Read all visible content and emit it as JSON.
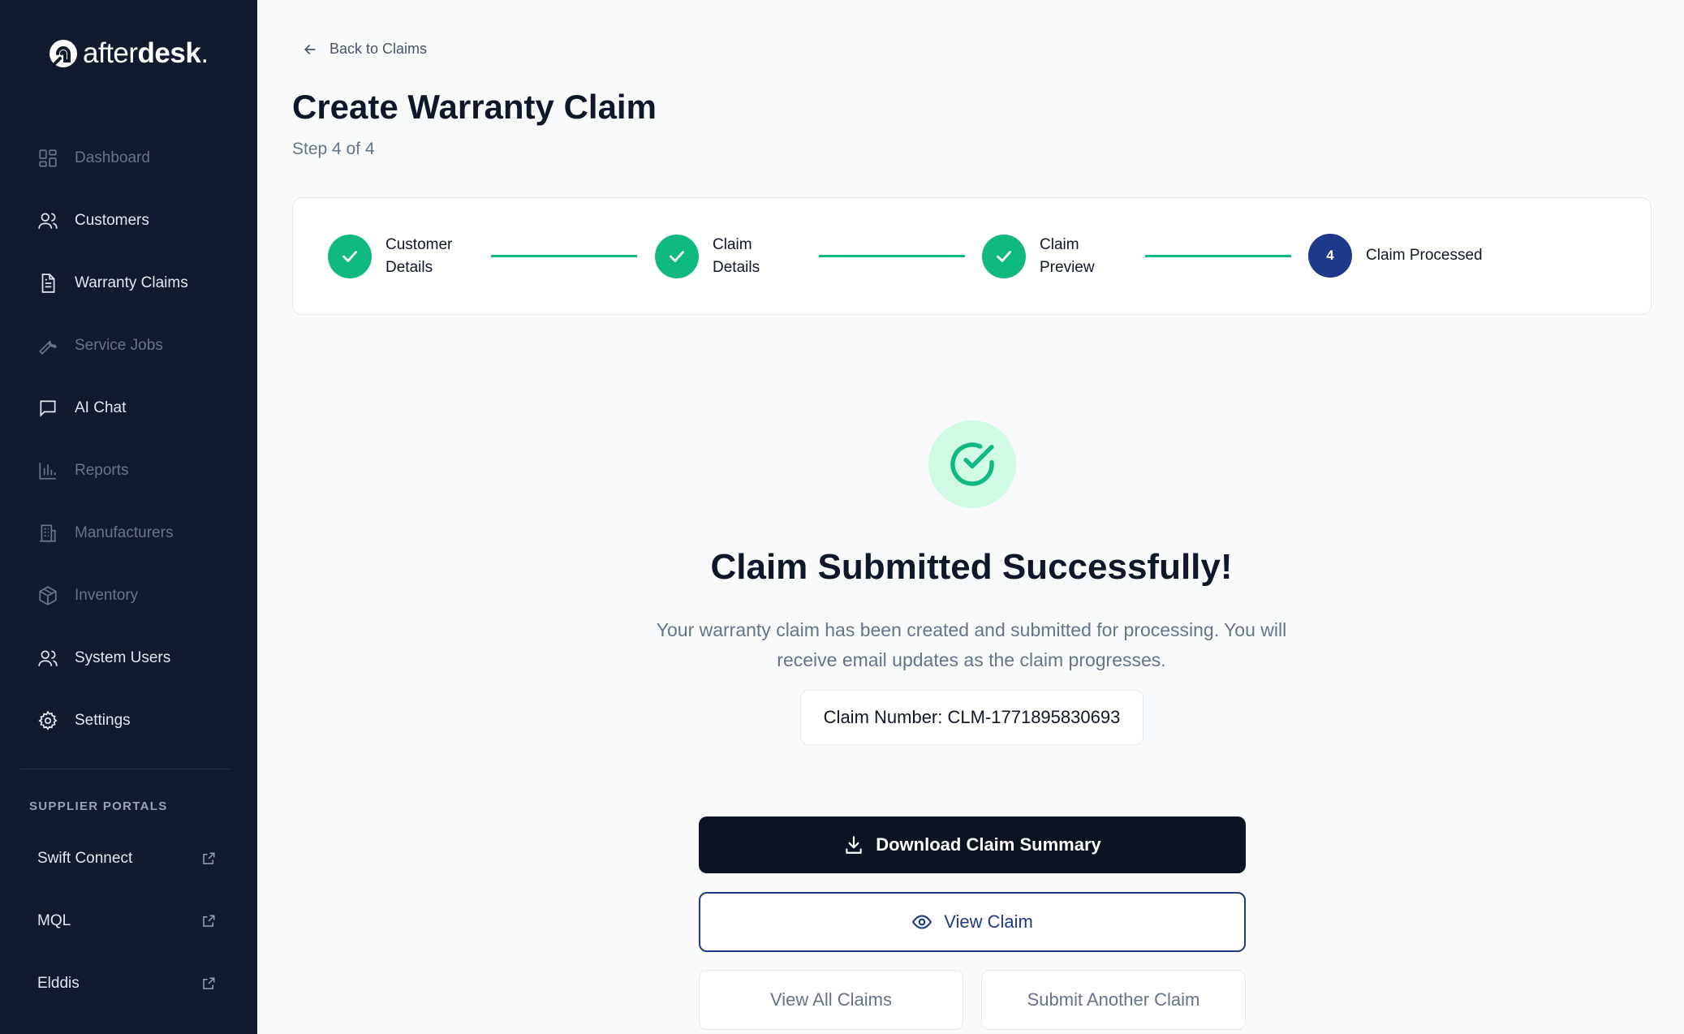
{
  "sidebar": {
    "brand": {
      "light": "after",
      "bold": "desk",
      "dot": "."
    },
    "items": [
      {
        "label": "Dashboard",
        "icon": "dashboard-icon",
        "dim": true
      },
      {
        "label": "Customers",
        "icon": "users-icon",
        "dim": false
      },
      {
        "label": "Warranty Claims",
        "icon": "document-icon",
        "dim": false
      },
      {
        "label": "Service Jobs",
        "icon": "wrench-icon",
        "dim": true
      },
      {
        "label": "AI Chat",
        "icon": "chat-icon",
        "dim": false
      },
      {
        "label": "Reports",
        "icon": "bar-chart-icon",
        "dim": true
      },
      {
        "label": "Manufacturers",
        "icon": "building-icon",
        "dim": true
      },
      {
        "label": "Inventory",
        "icon": "box-icon",
        "dim": true
      },
      {
        "label": "System Users",
        "icon": "users-icon",
        "dim": false
      },
      {
        "label": "Settings",
        "icon": "gear-icon",
        "dim": false
      }
    ],
    "portals_title": "SUPPLIER PORTALS",
    "portals": [
      {
        "label": "Swift Connect",
        "icon": "external-link-icon"
      },
      {
        "label": "MQL",
        "icon": "external-link-icon"
      },
      {
        "label": "Elddis",
        "icon": "external-link-icon"
      }
    ]
  },
  "header": {
    "back_label": "Back to Claims",
    "title": "Create Warranty Claim",
    "step_indicator": "Step 4 of 4"
  },
  "stepper": {
    "steps": [
      {
        "line1": "Customer",
        "line2": "Details",
        "status": "complete"
      },
      {
        "line1": "Claim",
        "line2": "Details",
        "status": "complete"
      },
      {
        "line1": "Claim",
        "line2": "Preview",
        "status": "complete"
      },
      {
        "number": "4",
        "label": "Claim Processed",
        "status": "current"
      }
    ]
  },
  "success": {
    "title": "Claim Submitted Successfully!",
    "message": "Your warranty claim has been created and submitted for processing. You will receive email updates as the claim progresses.",
    "claim_number": "Claim Number: CLM-1771895830693"
  },
  "actions": {
    "download": "Download Claim Summary",
    "view_claim": "View Claim",
    "view_all": "View All Claims",
    "submit_another": "Submit Another Claim"
  },
  "colors": {
    "sidebar_bg": "#111a2e",
    "success_green": "#10b981",
    "primary_navy": "#1e3a8a",
    "page_bg": "#f8fafc"
  }
}
